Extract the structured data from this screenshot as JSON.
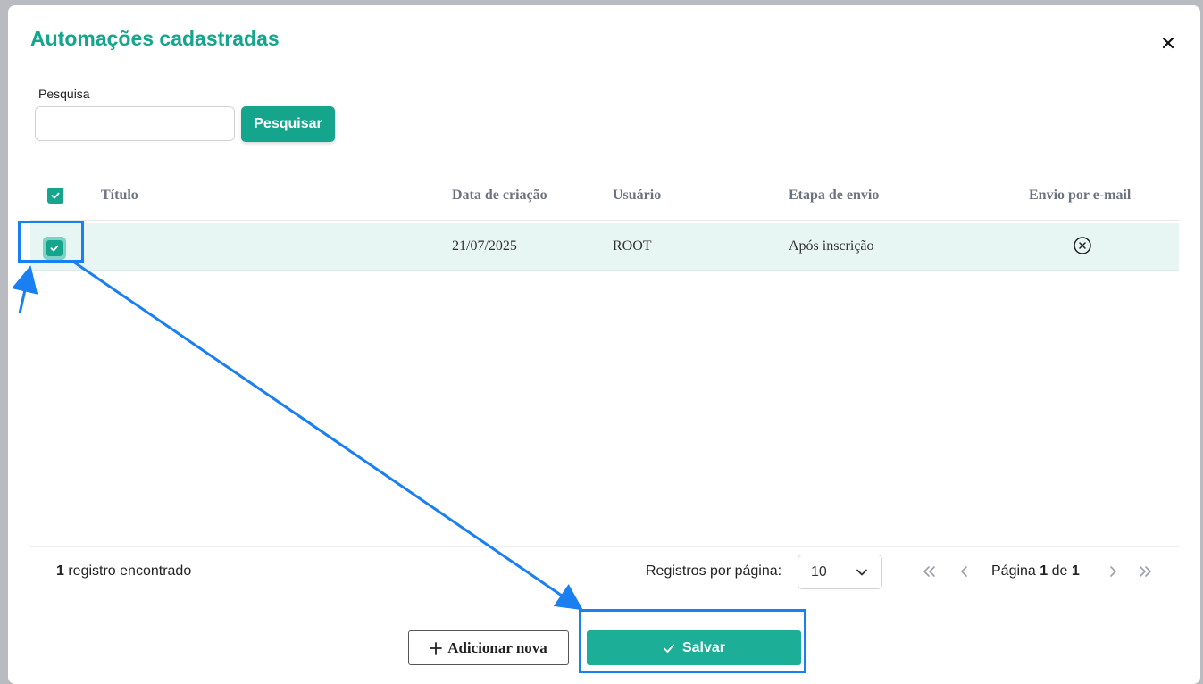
{
  "modal": {
    "title": "Automações cadastradas",
    "close_icon": "close-icon"
  },
  "search": {
    "label": "Pesquisa",
    "value": "",
    "placeholder": "",
    "button_label": "Pesquisar"
  },
  "table": {
    "header_checkbox_checked": true,
    "columns": [
      "Título",
      "Data de criação",
      "Usuário",
      "Etapa de envio",
      "Envio por e-mail"
    ],
    "rows": [
      {
        "checked": true,
        "titulo": "",
        "data_criacao": "21/07/2025",
        "usuario": "ROOT",
        "etapa": "Após inscrição",
        "envio_email_icon": "x-circle-icon"
      }
    ]
  },
  "footer": {
    "count_number": "1",
    "count_text": " registro encontrado",
    "per_page_label": "Registros por página:",
    "per_page_value": "10",
    "page_prefix": "Página ",
    "page_current": "1",
    "page_of": " de ",
    "page_total": "1"
  },
  "actions": {
    "add_label": "Adicionar nova",
    "save_label": "Salvar"
  },
  "colors": {
    "accent": "#14a58c",
    "annotation": "#1a7ff0",
    "selected_row": "#e8f6f3"
  }
}
